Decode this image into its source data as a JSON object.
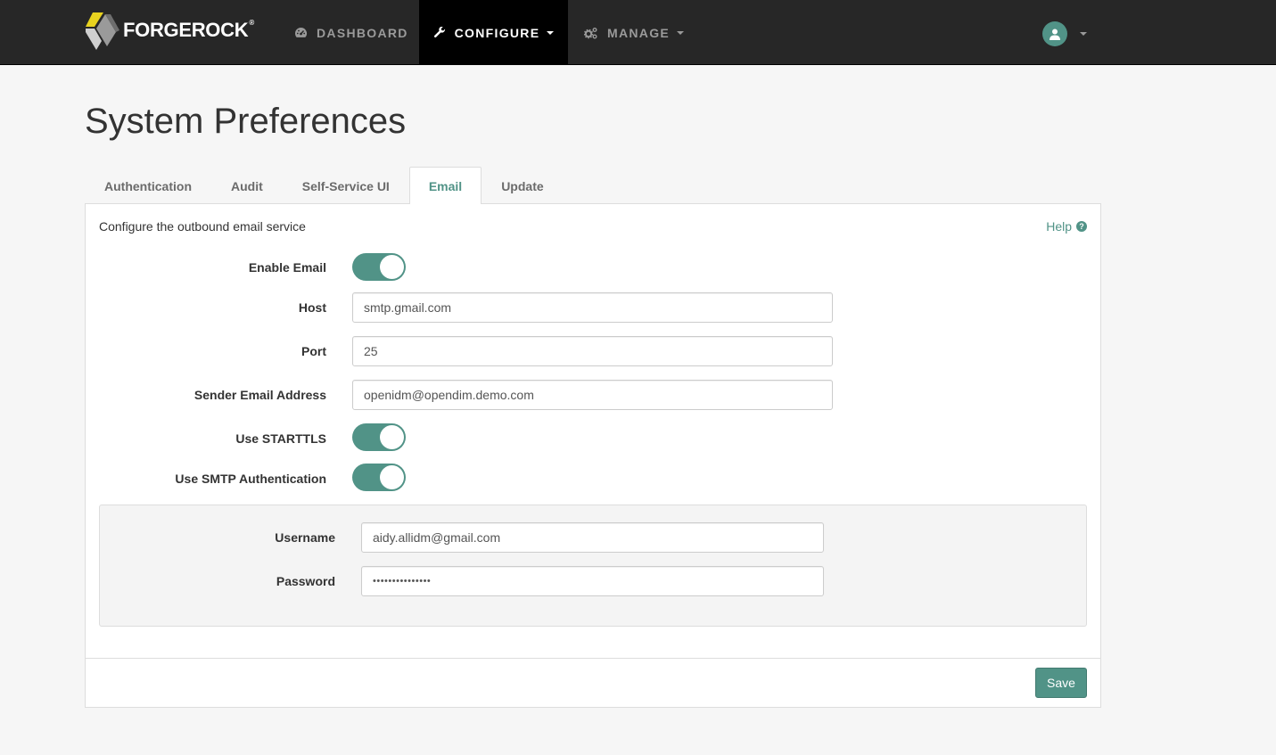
{
  "brand": {
    "name": "FORGEROCK",
    "mark": "®"
  },
  "nav": {
    "dashboard": {
      "label": "DASHBOARD",
      "icon": "dashboard-icon"
    },
    "configure": {
      "label": "CONFIGURE",
      "icon": "wrench-icon"
    },
    "manage": {
      "label": "MANAGE",
      "icon": "cogs-icon"
    }
  },
  "page": {
    "title": "System Preferences"
  },
  "tabs": [
    {
      "label": "Authentication"
    },
    {
      "label": "Audit"
    },
    {
      "label": "Self-Service UI"
    },
    {
      "label": "Email"
    },
    {
      "label": "Update"
    }
  ],
  "panel": {
    "description": "Configure the outbound email service",
    "help_label": "Help",
    "help_icon": "?"
  },
  "form": {
    "enable_email": {
      "label": "Enable Email",
      "on": true
    },
    "host": {
      "label": "Host",
      "value": "smtp.gmail.com"
    },
    "port": {
      "label": "Port",
      "value": "25"
    },
    "sender": {
      "label": "Sender Email Address",
      "value": "openidm@opendim.demo.com"
    },
    "starttls": {
      "label": "Use STARTTLS",
      "on": true
    },
    "smtp_auth": {
      "label": "Use SMTP Authentication",
      "on": true
    },
    "username": {
      "label": "Username",
      "value": "aidy.allidm@gmail.com"
    },
    "password": {
      "label": "Password",
      "value": "•••••••••••••••"
    }
  },
  "save_label": "Save",
  "colors": {
    "accent": "#519387",
    "topbar": "#272727",
    "background": "#f6f6f6"
  }
}
